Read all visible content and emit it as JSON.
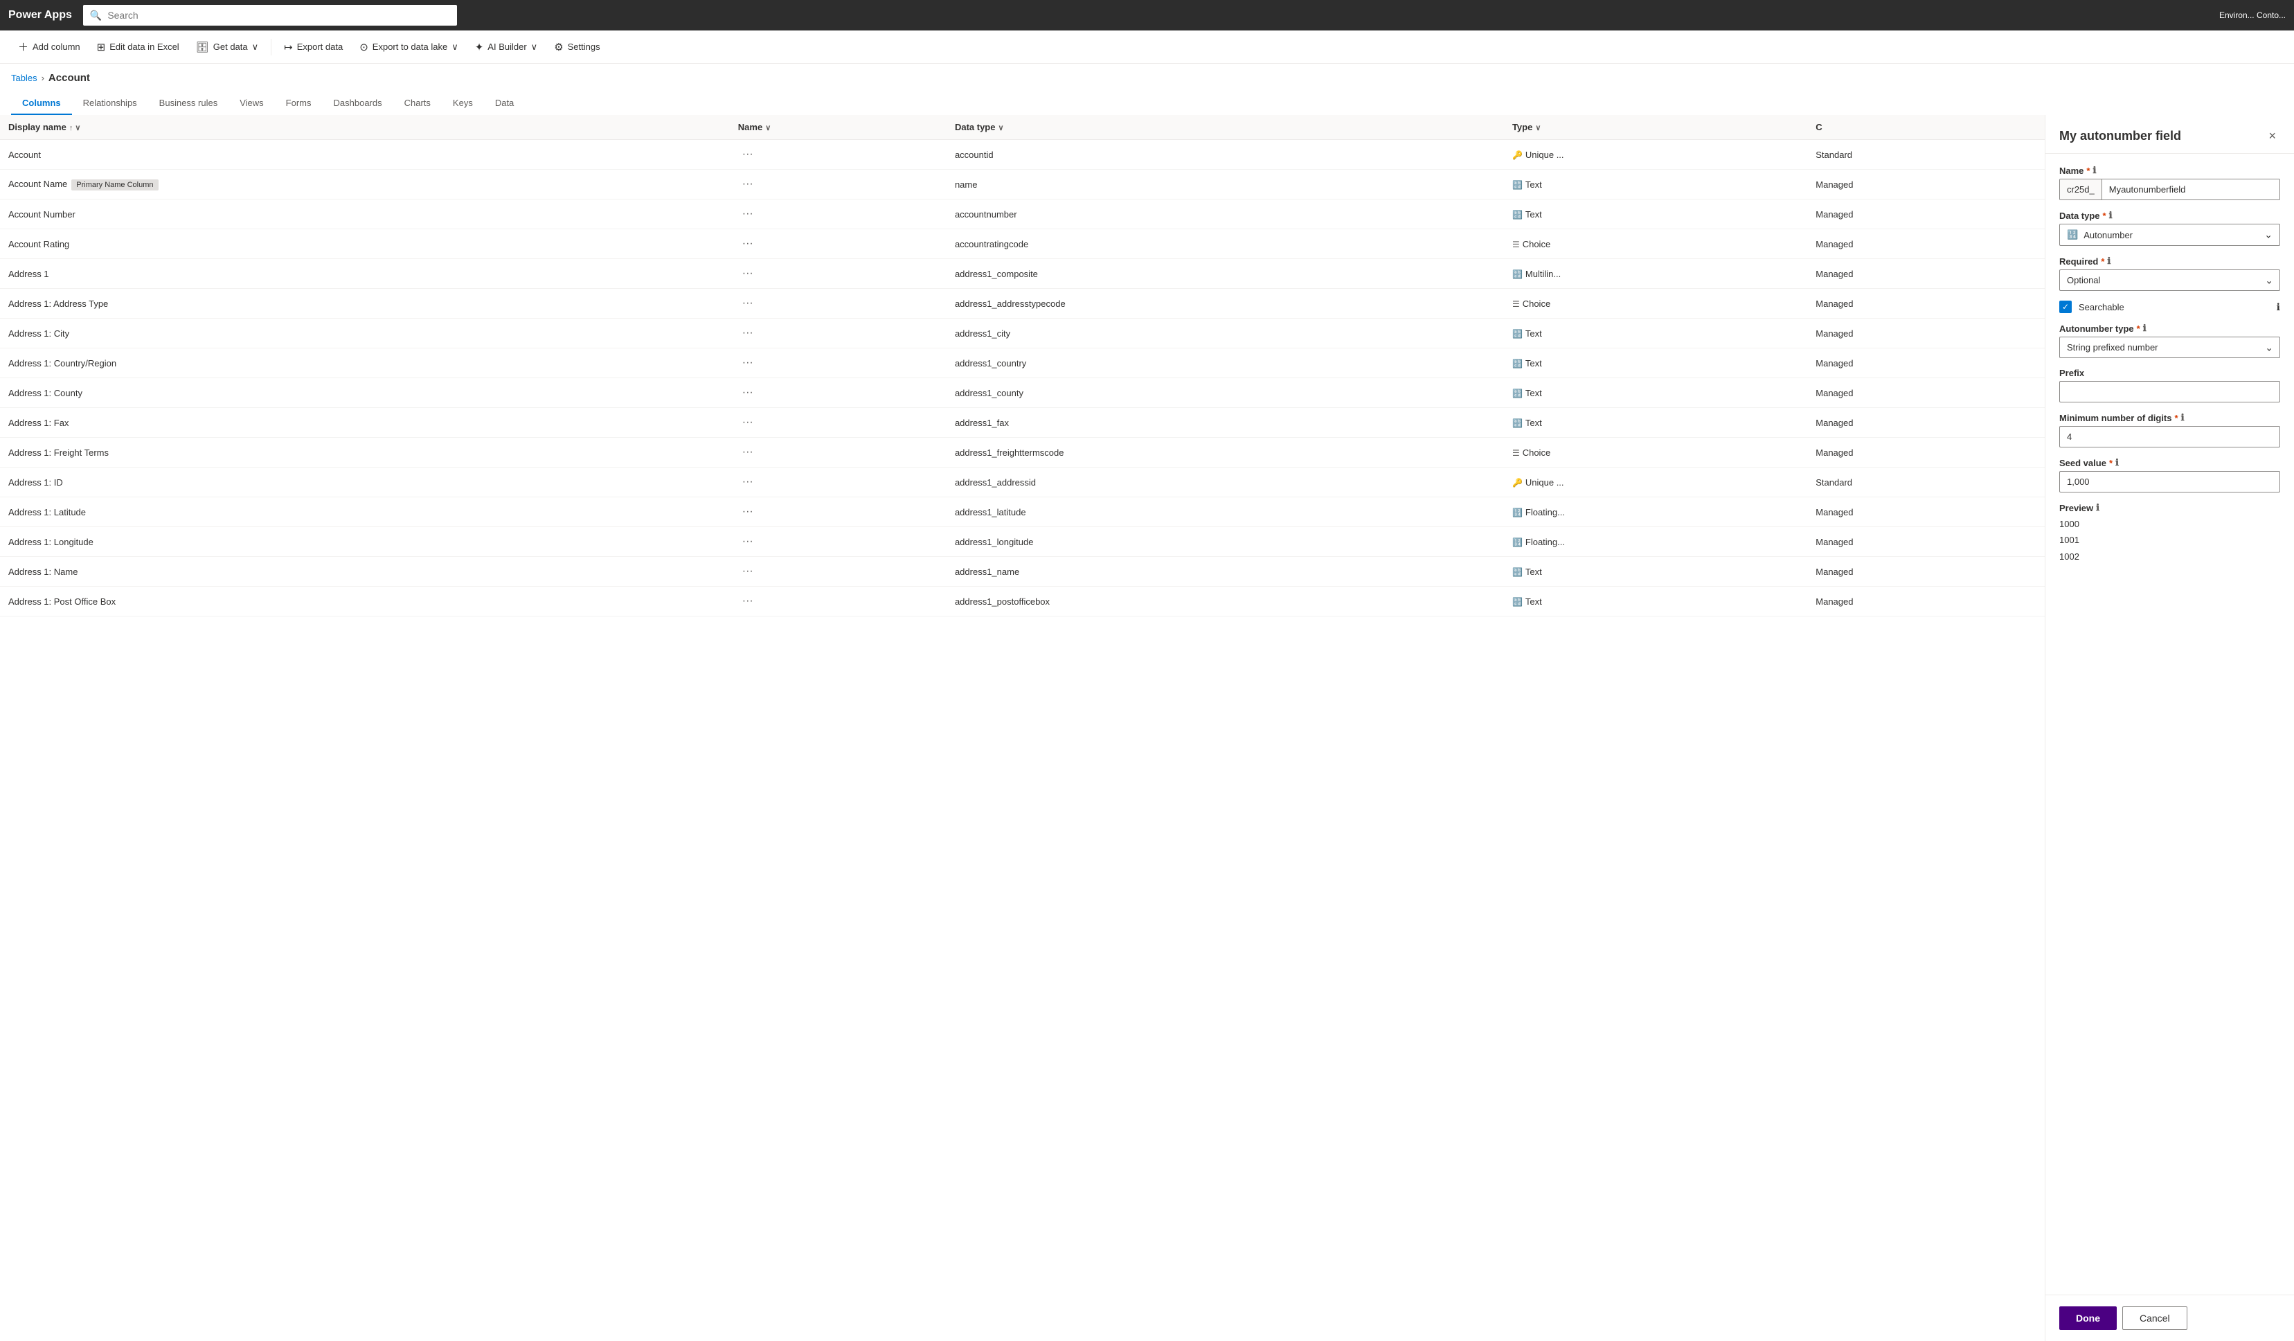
{
  "app": {
    "logo": "Power Apps",
    "search_placeholder": "Search",
    "topbar_right": "Environ... Conto..."
  },
  "toolbar": {
    "add_column": "Add column",
    "edit_excel": "Edit data in Excel",
    "get_data": "Get data",
    "export_data": "Export data",
    "export_lake": "Export to data lake",
    "ai_builder": "AI Builder",
    "settings": "Settings"
  },
  "breadcrumb": {
    "tables": "Tables",
    "separator": "›",
    "current": "Account"
  },
  "tabs": [
    {
      "id": "columns",
      "label": "Columns",
      "active": true
    },
    {
      "id": "relationships",
      "label": "Relationships",
      "active": false
    },
    {
      "id": "business-rules",
      "label": "Business rules",
      "active": false
    },
    {
      "id": "views",
      "label": "Views",
      "active": false
    },
    {
      "id": "forms",
      "label": "Forms",
      "active": false
    },
    {
      "id": "dashboards",
      "label": "Dashboards",
      "active": false
    },
    {
      "id": "charts",
      "label": "Charts",
      "active": false
    },
    {
      "id": "keys",
      "label": "Keys",
      "active": false
    },
    {
      "id": "data",
      "label": "Data",
      "active": false
    }
  ],
  "table": {
    "columns": [
      {
        "id": "display-name",
        "label": "Display name",
        "sortable": true,
        "sort_dir": "↑"
      },
      {
        "id": "name",
        "label": "Name",
        "sortable": true
      },
      {
        "id": "data-type",
        "label": "Data type",
        "sortable": true
      },
      {
        "id": "type",
        "label": "Type",
        "sortable": true
      },
      {
        "id": "custom",
        "label": "C",
        "sortable": false
      }
    ],
    "rows": [
      {
        "display_name": "Account",
        "badge": "",
        "name_ellipsis": "···",
        "name": "accountid",
        "datatype_icon": "🔑",
        "datatype": "Unique ...",
        "type": "Standard",
        "custom": ""
      },
      {
        "display_name": "Account Name",
        "badge": "Primary Name Column",
        "name_ellipsis": "···",
        "name": "name",
        "datatype_icon": "🔡",
        "datatype": "Text",
        "type": "Managed",
        "custom": ""
      },
      {
        "display_name": "Account Number",
        "badge": "",
        "name_ellipsis": "···",
        "name": "accountnumber",
        "datatype_icon": "🔡",
        "datatype": "Text",
        "type": "Managed",
        "custom": ""
      },
      {
        "display_name": "Account Rating",
        "badge": "",
        "name_ellipsis": "···",
        "name": "accountratingcode",
        "datatype_icon": "☰",
        "datatype": "Choice",
        "type": "Managed",
        "custom": ""
      },
      {
        "display_name": "Address 1",
        "badge": "",
        "name_ellipsis": "···",
        "name": "address1_composite",
        "datatype_icon": "🔡",
        "datatype": "Multilin...",
        "type": "Managed",
        "custom": ""
      },
      {
        "display_name": "Address 1: Address Type",
        "badge": "",
        "name_ellipsis": "···",
        "name": "address1_addresstypecode",
        "datatype_icon": "☰",
        "datatype": "Choice",
        "type": "Managed",
        "custom": ""
      },
      {
        "display_name": "Address 1: City",
        "badge": "",
        "name_ellipsis": "···",
        "name": "address1_city",
        "datatype_icon": "🔡",
        "datatype": "Text",
        "type": "Managed",
        "custom": ""
      },
      {
        "display_name": "Address 1: Country/Region",
        "badge": "",
        "name_ellipsis": "···",
        "name": "address1_country",
        "datatype_icon": "🔡",
        "datatype": "Text",
        "type": "Managed",
        "custom": ""
      },
      {
        "display_name": "Address 1: County",
        "badge": "",
        "name_ellipsis": "···",
        "name": "address1_county",
        "datatype_icon": "🔡",
        "datatype": "Text",
        "type": "Managed",
        "custom": ""
      },
      {
        "display_name": "Address 1: Fax",
        "badge": "",
        "name_ellipsis": "···",
        "name": "address1_fax",
        "datatype_icon": "🔡",
        "datatype": "Text",
        "type": "Managed",
        "custom": ""
      },
      {
        "display_name": "Address 1: Freight Terms",
        "badge": "",
        "name_ellipsis": "···",
        "name": "address1_freighttermscode",
        "datatype_icon": "☰",
        "datatype": "Choice",
        "type": "Managed",
        "custom": ""
      },
      {
        "display_name": "Address 1: ID",
        "badge": "",
        "name_ellipsis": "···",
        "name": "address1_addressid",
        "datatype_icon": "🔑",
        "datatype": "Unique ...",
        "type": "Standard",
        "custom": ""
      },
      {
        "display_name": "Address 1: Latitude",
        "badge": "",
        "name_ellipsis": "···",
        "name": "address1_latitude",
        "datatype_icon": "🔢",
        "datatype": "Floating...",
        "type": "Managed",
        "custom": ""
      },
      {
        "display_name": "Address 1: Longitude",
        "badge": "",
        "name_ellipsis": "···",
        "name": "address1_longitude",
        "datatype_icon": "🔢",
        "datatype": "Floating...",
        "type": "Managed",
        "custom": ""
      },
      {
        "display_name": "Address 1: Name",
        "badge": "",
        "name_ellipsis": "···",
        "name": "address1_name",
        "datatype_icon": "🔡",
        "datatype": "Text",
        "type": "Managed",
        "custom": ""
      },
      {
        "display_name": "Address 1: Post Office Box",
        "badge": "",
        "name_ellipsis": "···",
        "name": "address1_postofficebox",
        "datatype_icon": "🔡",
        "datatype": "Text",
        "type": "Managed",
        "custom": ""
      }
    ]
  },
  "side_panel": {
    "title": "My autonumber field",
    "close_label": "×",
    "fields": {
      "name_label": "Name",
      "name_prefix": "cr25d_",
      "name_value": "Myautonumberfield",
      "datatype_label": "Data type",
      "datatype_icon": "🔢",
      "datatype_value": "Autonumber",
      "required_label": "Required",
      "required_value": "Optional",
      "searchable_label": "Searchable",
      "autonumber_type_label": "Autonumber type",
      "autonumber_type_value": "String prefixed number",
      "prefix_label": "Prefix",
      "prefix_value": "",
      "min_digits_label": "Minimum number of digits",
      "min_digits_value": "4",
      "seed_label": "Seed value",
      "seed_value": "1,000",
      "preview_label": "Preview",
      "preview_values": [
        "1000",
        "1001",
        "1002"
      ]
    },
    "footer": {
      "done_label": "Done",
      "cancel_label": "Cancel"
    }
  }
}
